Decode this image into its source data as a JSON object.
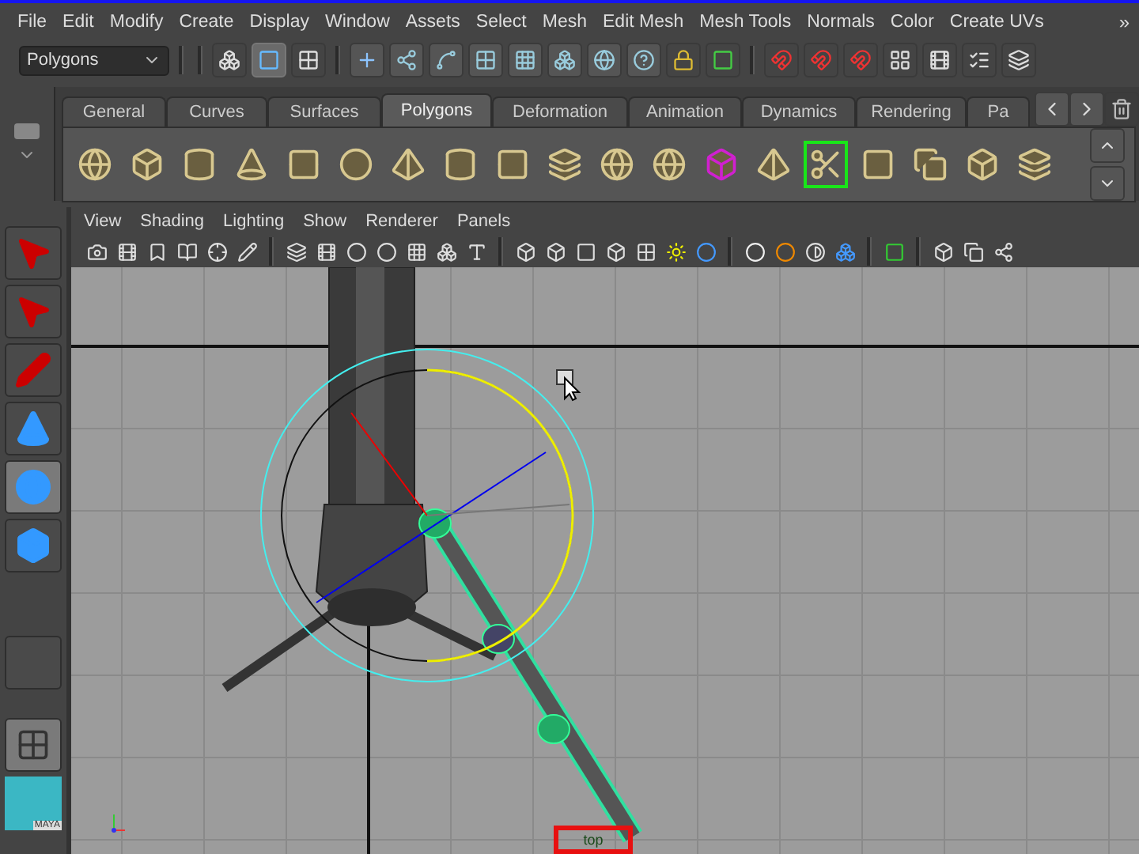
{
  "menu_bar": {
    "items": [
      "File",
      "Edit",
      "Modify",
      "Create",
      "Display",
      "Window",
      "Assets",
      "Select",
      "Mesh",
      "Edit Mesh",
      "Mesh Tools",
      "Normals",
      "Color",
      "Create UVs"
    ],
    "overflow": "»"
  },
  "status_line": {
    "mode_dropdown": {
      "value": "Polygons"
    },
    "selection_modes": [
      {
        "selected": false
      },
      {
        "selected": true
      },
      {
        "selected": false
      }
    ]
  },
  "shelf": {
    "tabs": [
      {
        "label": "General",
        "selected": false
      },
      {
        "label": "Curves",
        "selected": false
      },
      {
        "label": "Surfaces",
        "selected": false
      },
      {
        "label": "Polygons",
        "selected": true
      },
      {
        "label": "Deformation",
        "selected": false
      },
      {
        "label": "Animation",
        "selected": false
      },
      {
        "label": "Dynamics",
        "selected": false
      },
      {
        "label": "Rendering",
        "selected": false
      },
      {
        "label": "Pa",
        "selected": false
      }
    ]
  },
  "toolbox": {
    "tools": [
      {
        "selected": false
      },
      {
        "selected": false
      },
      {
        "selected": false
      },
      {
        "selected": false
      },
      {
        "selected": true
      },
      {
        "selected": false
      }
    ],
    "logo_text": "MAYA"
  },
  "panel": {
    "menus": [
      "View",
      "Shading",
      "Lighting",
      "Show",
      "Renderer",
      "Panels"
    ],
    "camera_label": "top"
  }
}
